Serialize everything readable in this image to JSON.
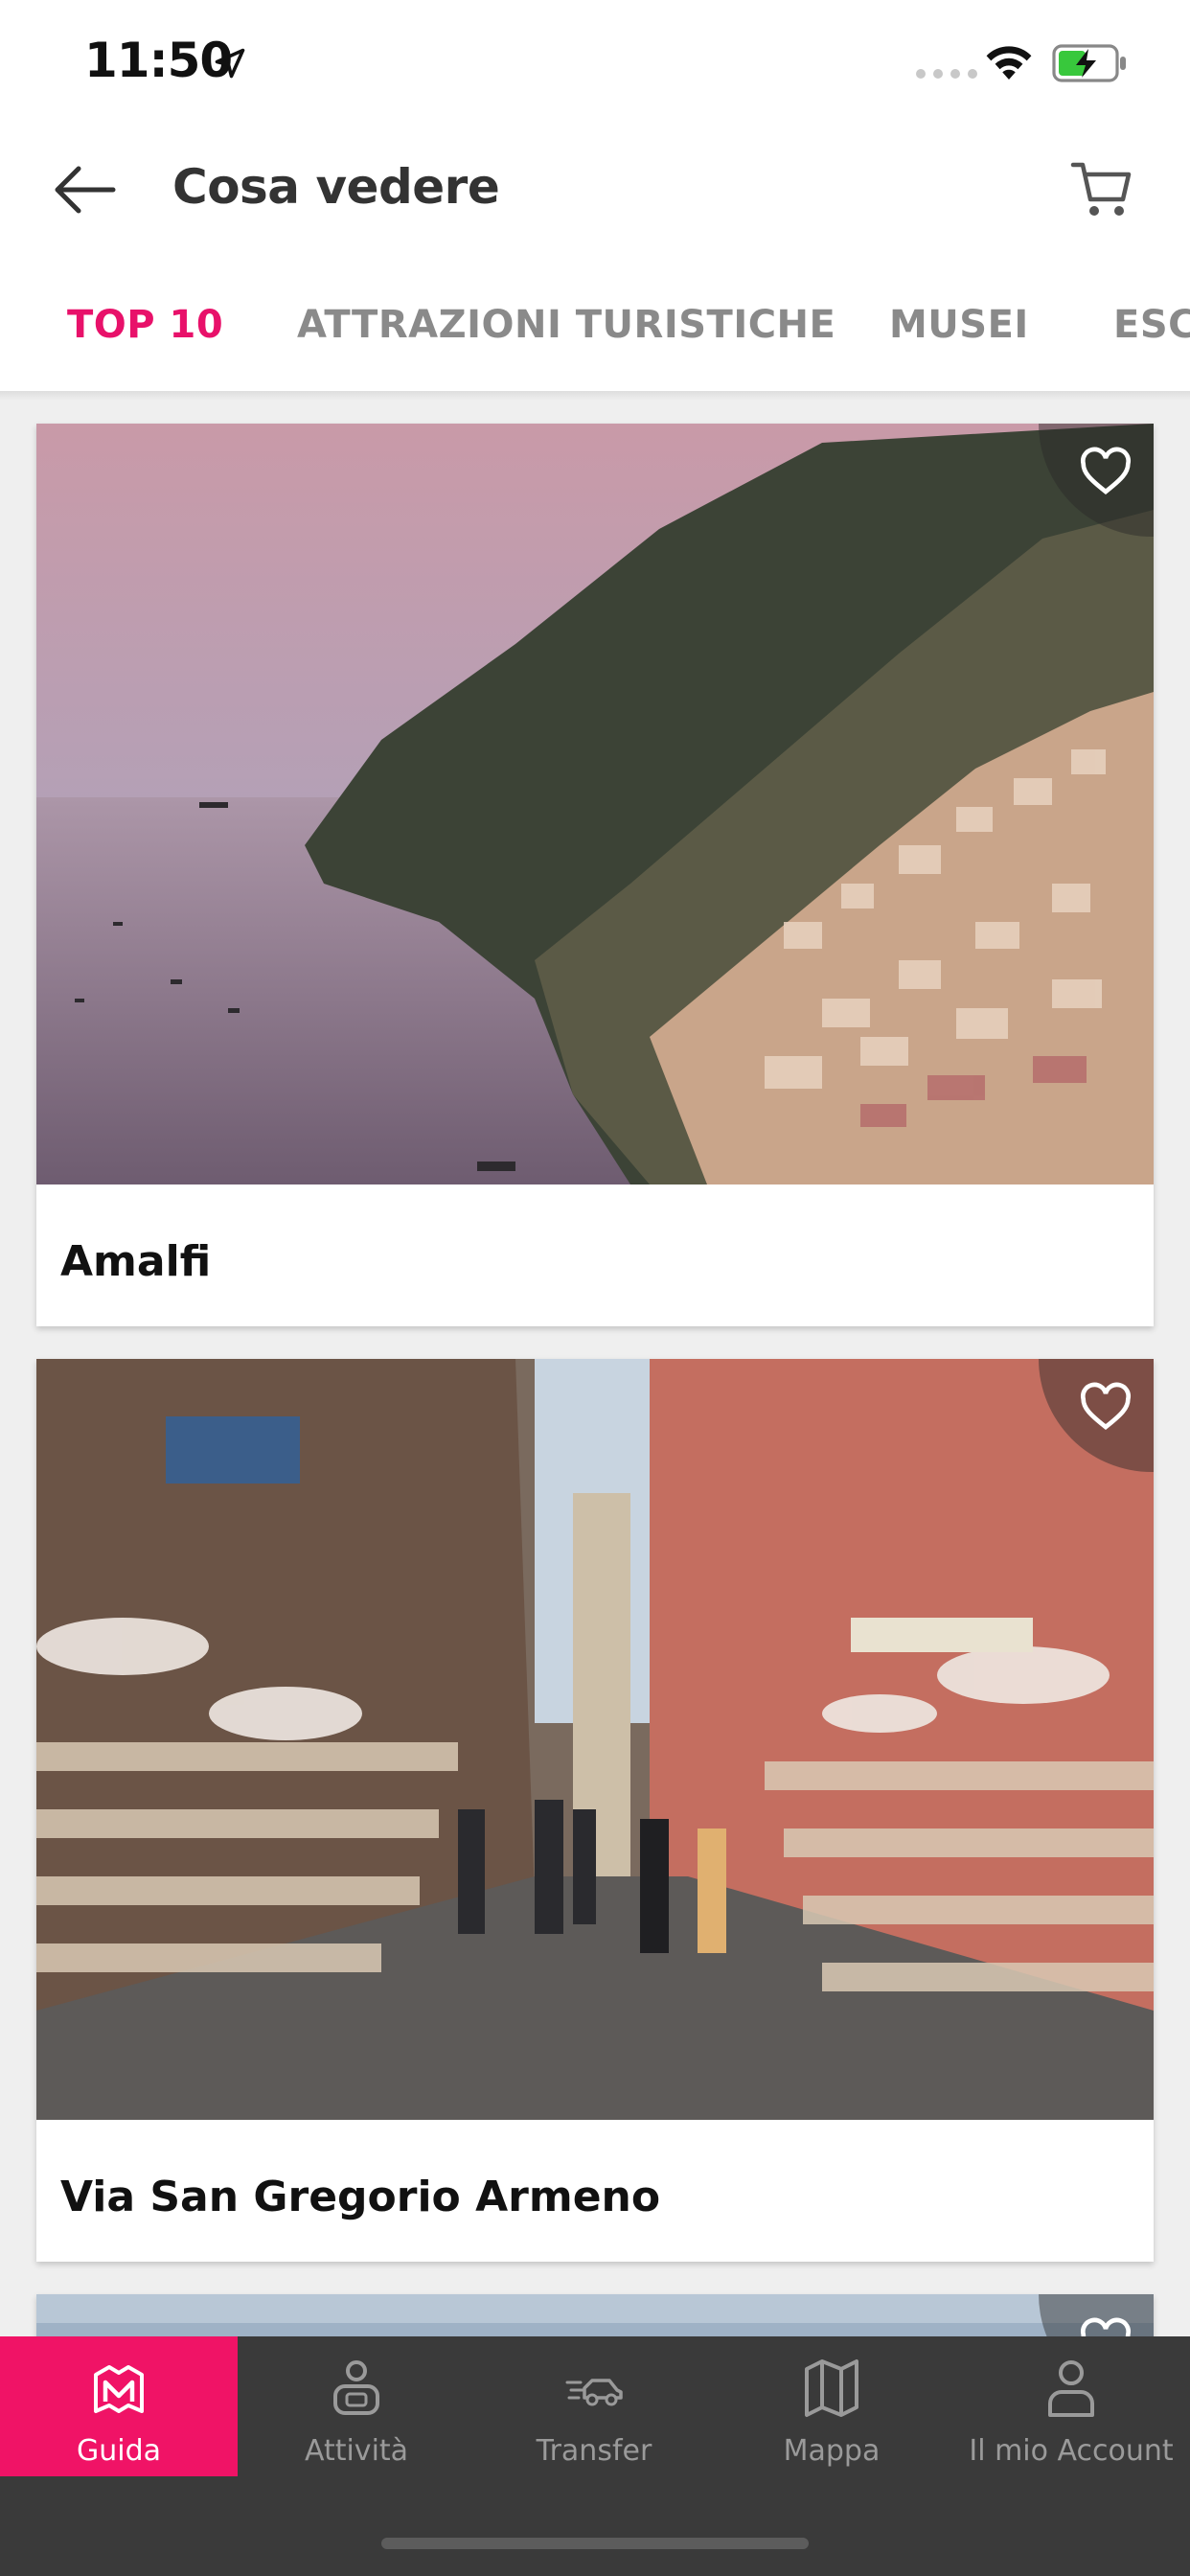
{
  "status_bar": {
    "time": "11:50",
    "battery_color": "#38c83c"
  },
  "header": {
    "title": "Cosa vedere"
  },
  "tabs": [
    {
      "label": "TOP 10",
      "active": true
    },
    {
      "label": "ATTRAZIONI TURISTICHE",
      "active": false
    },
    {
      "label": "MUSEI",
      "active": false
    },
    {
      "label": "ESC",
      "active": false
    }
  ],
  "cards": [
    {
      "title": "Amalfi",
      "image": "coastal-cliff-town-at-sunset"
    },
    {
      "title": "Via San Gregorio Armeno",
      "image": "narrow-market-street"
    },
    {
      "title": "",
      "image": "coastline-partial"
    }
  ],
  "bottom_nav": [
    {
      "label": "Guida",
      "icon": "map-m-icon",
      "active": true
    },
    {
      "label": "Attività",
      "icon": "activity-person-icon",
      "active": false
    },
    {
      "label": "Transfer",
      "icon": "car-transfer-icon",
      "active": false
    },
    {
      "label": "Mappa",
      "icon": "folded-map-icon",
      "active": false
    },
    {
      "label": "Il mio Account",
      "icon": "account-person-icon",
      "active": false
    }
  ],
  "colors": {
    "accent": "#e8116a",
    "nav_bg": "#3a3a3a",
    "nav_active": "#f01366"
  }
}
